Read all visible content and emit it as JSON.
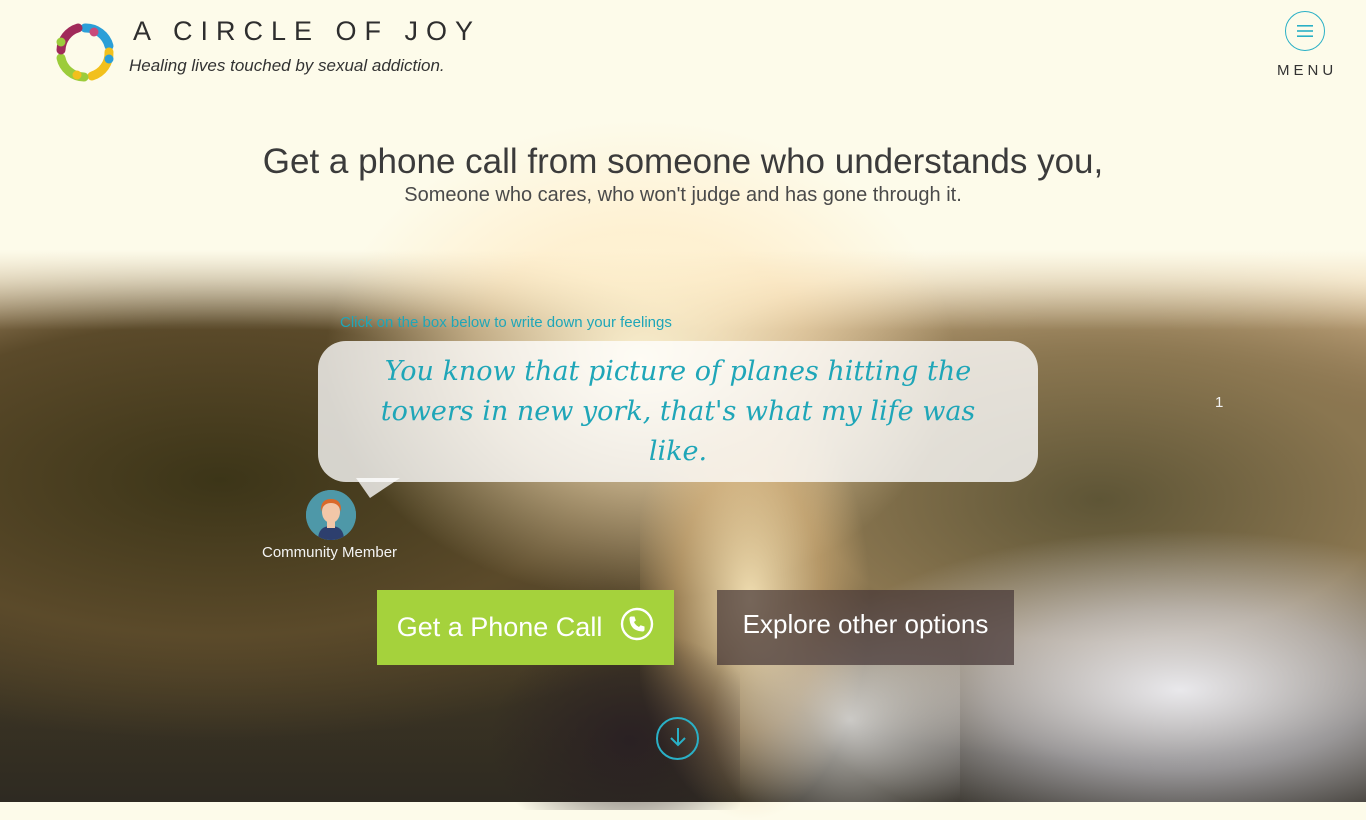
{
  "header": {
    "brand_title": "A CIRCLE OF JOY",
    "tagline": "Healing lives touched by sexual addiction.",
    "menu_label": "MENU",
    "logo_icon": "circle-of-people-logo",
    "menu_icon": "hamburger-icon"
  },
  "hero": {
    "headline": "Get a phone call from someone who  understands you,",
    "subheadline": "Someone who cares, who won't judge and has gone through it.",
    "instruction": "Click on the box below to write down your feelings",
    "quote": "You know that picture of planes hitting the towers in new york, that's what my life was like.",
    "counter": "1",
    "member_label": "Community Member",
    "call_button": "Get a Phone Call",
    "call_icon": "phone-icon",
    "explore_button": "Explore other options",
    "scroll_icon": "arrow-down-circle-icon"
  },
  "colors": {
    "accent_teal": "#2ab0c6",
    "quote_teal": "#1fa6b8",
    "call_green": "#a5d23c",
    "background_cream": "#fdfbea"
  }
}
